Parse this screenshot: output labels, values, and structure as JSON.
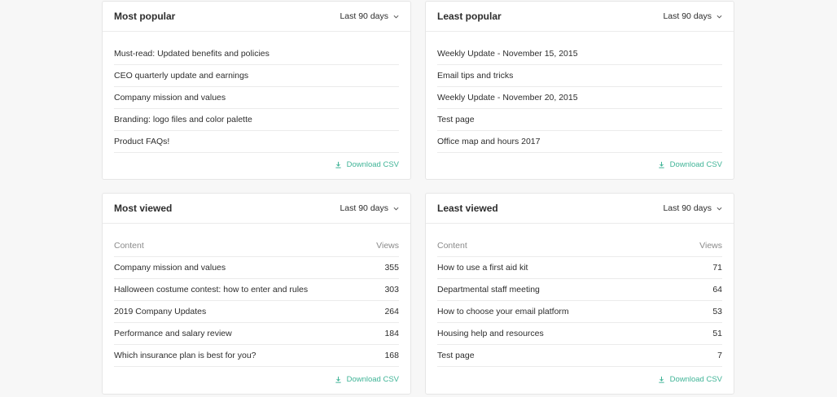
{
  "colors": {
    "accent": "#40b497",
    "muted": "#8a8a8a",
    "text": "#2d2d2d"
  },
  "cards": [
    {
      "title": "Most popular",
      "range": "Last 90 days",
      "items": [
        "Must-read: Updated benefits and policies",
        "CEO quarterly update and earnings",
        "Company mission and values",
        "Branding: logo files and color palette",
        "Product FAQs!"
      ],
      "download": "Download CSV"
    },
    {
      "title": "Least popular",
      "range": "Last 90 days",
      "items": [
        "Weekly Update - November 15, 2015",
        "Email tips and tricks",
        "Weekly Update - November 20, 2015",
        "Test page",
        "Office map and hours 2017"
      ],
      "download": "Download CSV"
    },
    {
      "title": "Most viewed",
      "range": "Last 90 days",
      "header": {
        "content": "Content",
        "views": "Views"
      },
      "rows": [
        {
          "name": "Company mission and values",
          "views": "355"
        },
        {
          "name": "Halloween costume contest: how to enter and rules",
          "views": "303"
        },
        {
          "name": "2019 Company Updates",
          "views": "264"
        },
        {
          "name": "Performance and salary review",
          "views": "184"
        },
        {
          "name": "Which insurance plan is best for you?",
          "views": "168"
        }
      ],
      "download": "Download CSV"
    },
    {
      "title": "Least viewed",
      "range": "Last 90 days",
      "header": {
        "content": "Content",
        "views": "Views"
      },
      "rows": [
        {
          "name": "How to use a first aid kit",
          "views": "71"
        },
        {
          "name": "Departmental staff meeting",
          "views": "64"
        },
        {
          "name": "How to choose your email platform",
          "views": "53"
        },
        {
          "name": "Housing help and resources",
          "views": "51"
        },
        {
          "name": "Test page",
          "views": "7"
        }
      ],
      "download": "Download CSV"
    }
  ]
}
